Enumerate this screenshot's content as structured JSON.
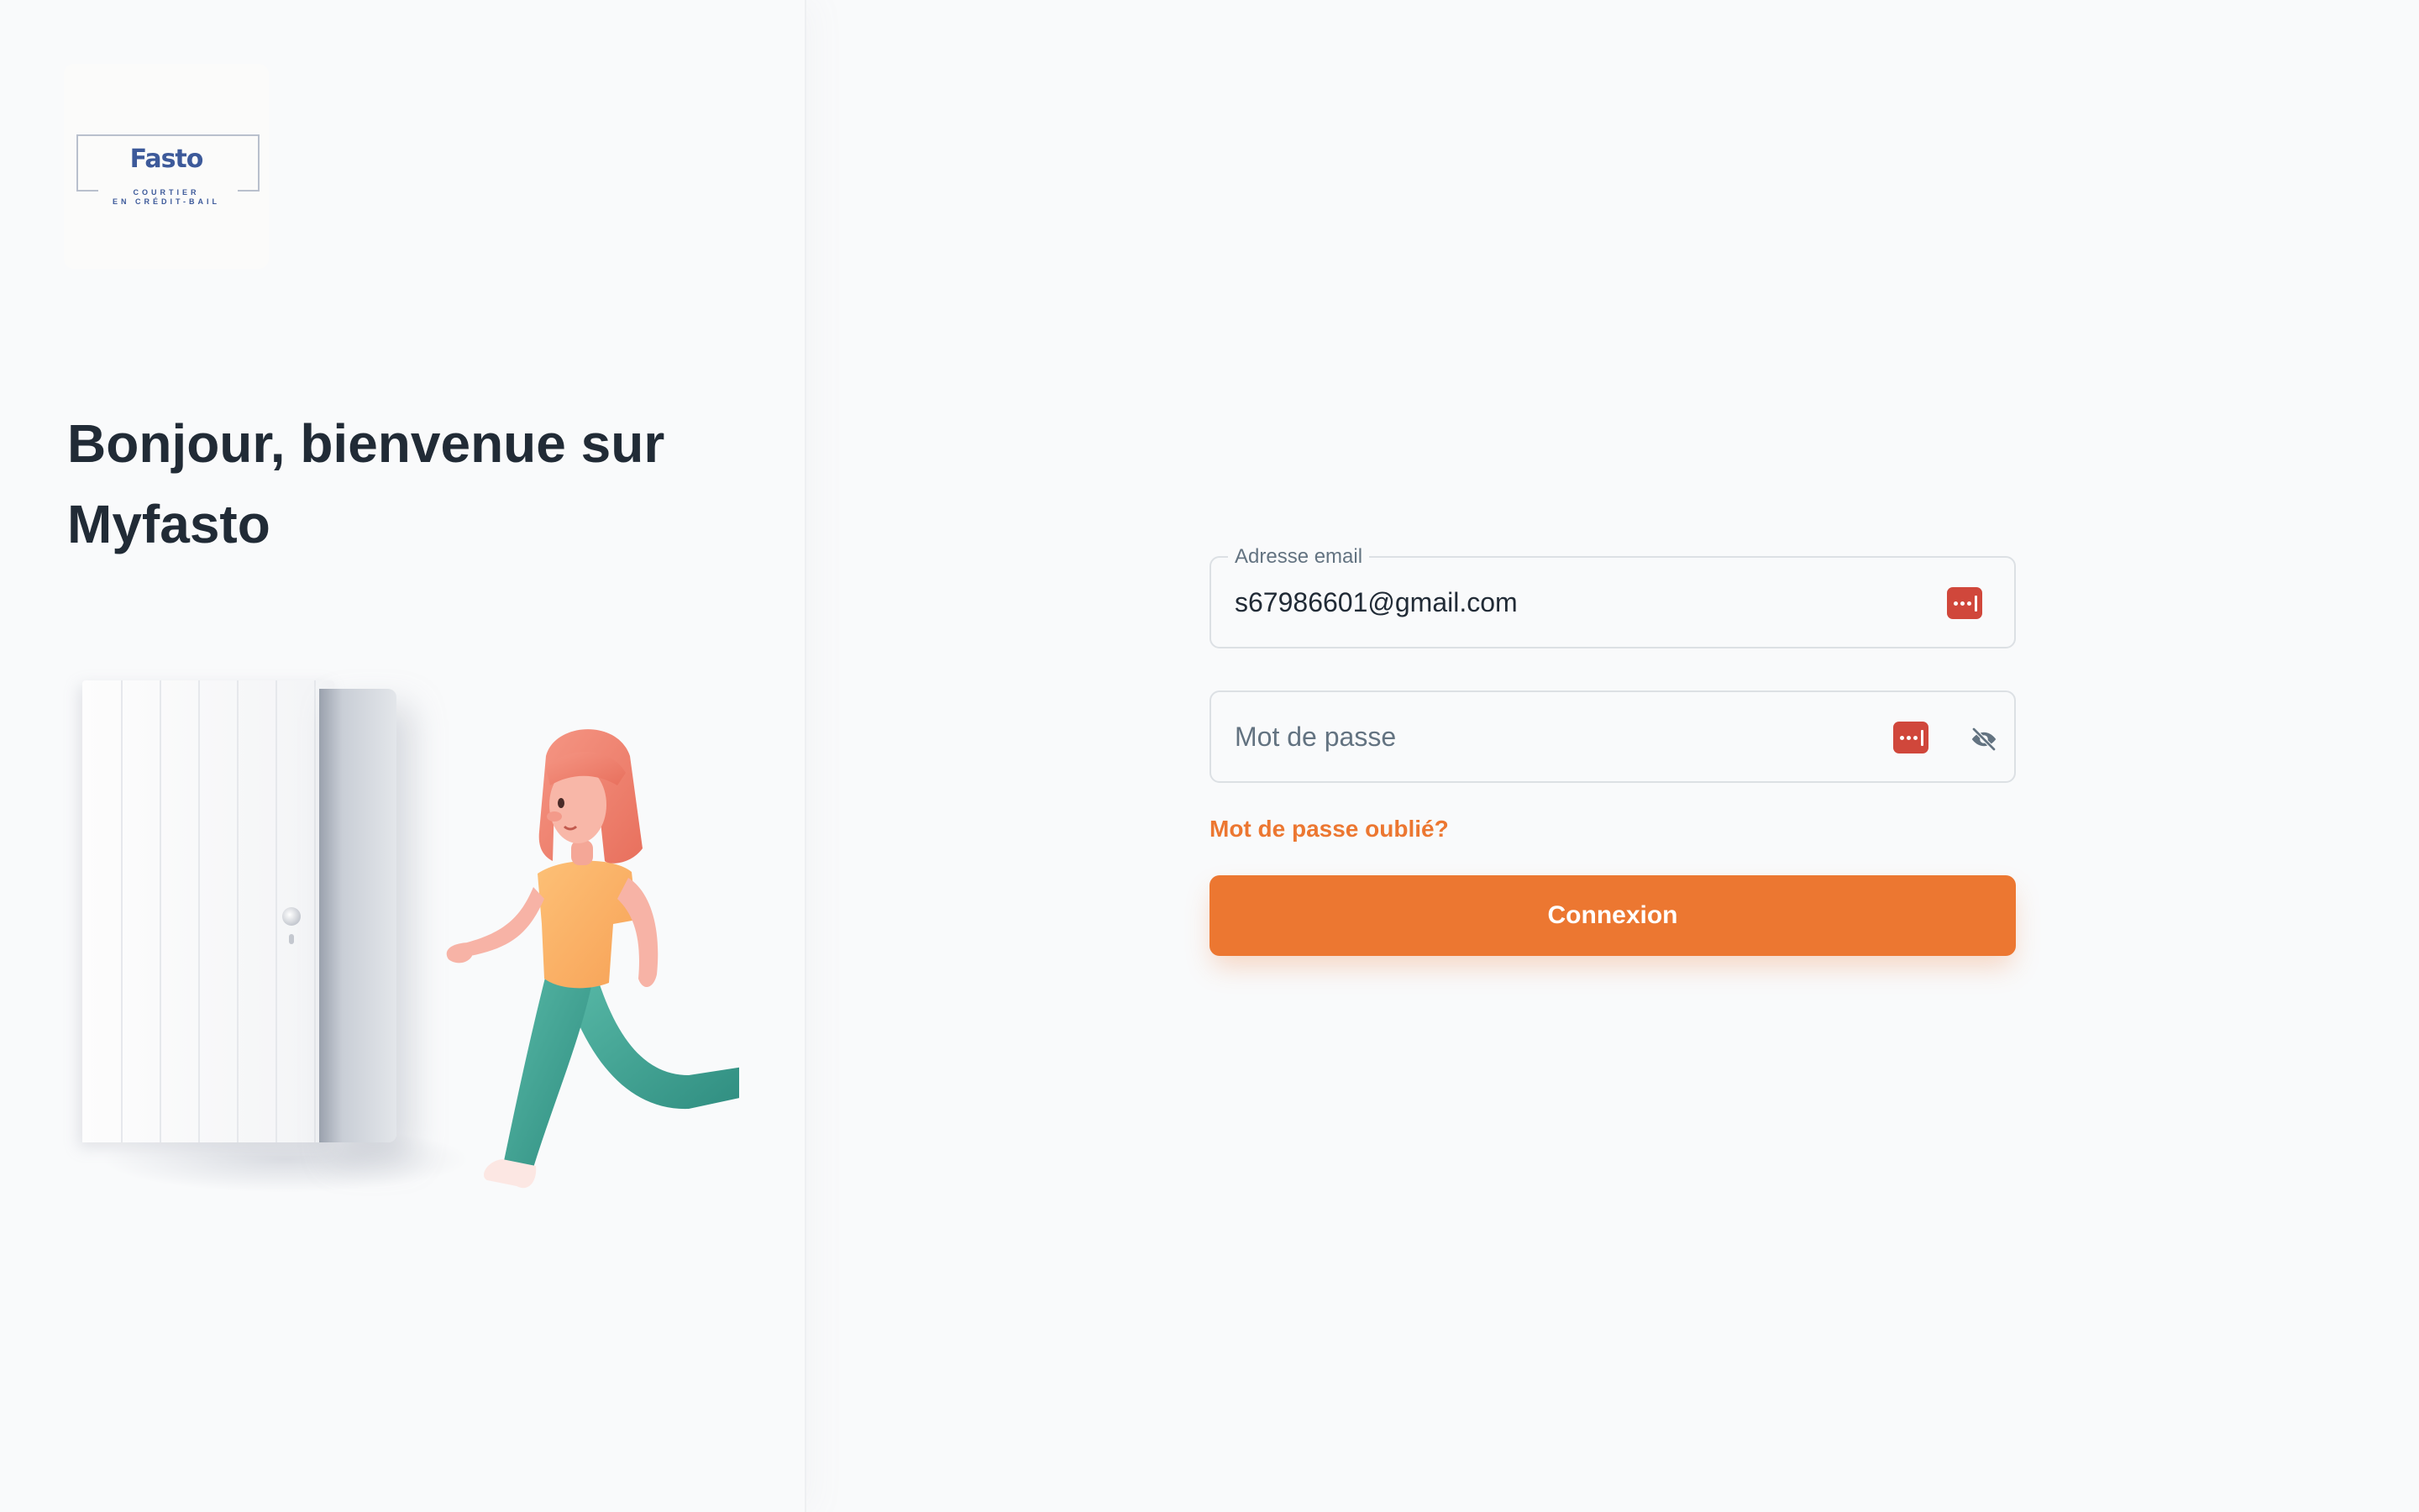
{
  "brand": {
    "logo_name": "Fasto",
    "logo_tagline_1": "COURTIER",
    "logo_tagline_2": "EN CRÉDIT-BAIL"
  },
  "hero": {
    "title": "Bonjour, bienvenue sur Myfasto"
  },
  "login_form": {
    "email_label": "Adresse email",
    "email_value": "s67986601@gmail.com",
    "password_placeholder": "Mot de passe",
    "password_value": "",
    "forgot_link": "Mot de passe oublié?",
    "submit_label": "Connexion"
  },
  "icons": {
    "password_manager": "password-manager-icon",
    "visibility_toggle": "eye-off-icon"
  },
  "colors": {
    "accent": "#ec7731",
    "heading": "#212b36",
    "muted": "#637381",
    "background": "#f9fafb",
    "border": "#dce0e4",
    "password_manager": "#d0473b",
    "logo": "#3d5a9a"
  }
}
